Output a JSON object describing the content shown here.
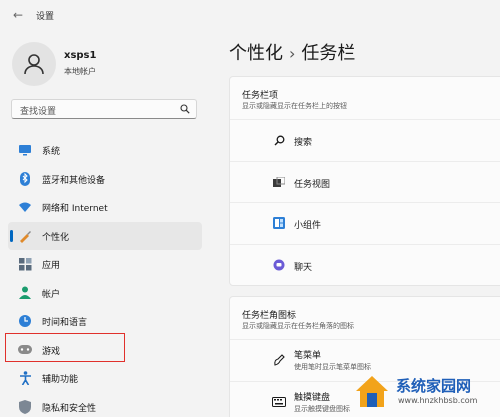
{
  "window": {
    "title": "设置"
  },
  "profile": {
    "name": "xsps1",
    "account_type": "本地帐户"
  },
  "search": {
    "placeholder": "查找设置"
  },
  "nav": [
    {
      "label": "系统",
      "icon": "monitor-icon"
    },
    {
      "label": "蓝牙和其他设备",
      "icon": "bluetooth-icon"
    },
    {
      "label": "网络和 Internet",
      "icon": "wifi-icon"
    },
    {
      "label": "个性化",
      "icon": "brush-icon",
      "selected": true
    },
    {
      "label": "应用",
      "icon": "apps-icon"
    },
    {
      "label": "帐户",
      "icon": "person-icon"
    },
    {
      "label": "时间和语言",
      "icon": "globe-clock-icon"
    },
    {
      "label": "游戏",
      "icon": "gamepad-icon"
    },
    {
      "label": "辅助功能",
      "icon": "accessibility-icon"
    },
    {
      "label": "隐私和安全性",
      "icon": "shield-icon"
    }
  ],
  "breadcrumb": {
    "parent": "个性化",
    "separator": "›",
    "current": "任务栏"
  },
  "taskbar_items": {
    "title": "任务栏项",
    "description": "显示或隐藏显示在任务栏上的按钮",
    "rows": [
      {
        "label": "搜索",
        "icon": "search-icon"
      },
      {
        "label": "任务视图",
        "icon": "task-view-icon"
      },
      {
        "label": "小组件",
        "icon": "widgets-icon"
      },
      {
        "label": "聊天",
        "icon": "chat-icon"
      }
    ]
  },
  "corner_icons": {
    "title": "任务栏角图标",
    "description": "显示或隐藏显示在任务栏角落的图标",
    "rows": [
      {
        "label": "笔菜单",
        "sub": "使用笔时显示笔菜单图标",
        "icon": "pen-icon"
      },
      {
        "label": "触摸键盘",
        "sub": "显示触摸键盘图标",
        "icon": "keyboard-icon"
      }
    ]
  },
  "watermark": {
    "text": "系统家园网",
    "url": "www.hnzkhbsb.com"
  },
  "colors": {
    "accent": "#0067c0",
    "highlight_box": "#e0302b"
  }
}
